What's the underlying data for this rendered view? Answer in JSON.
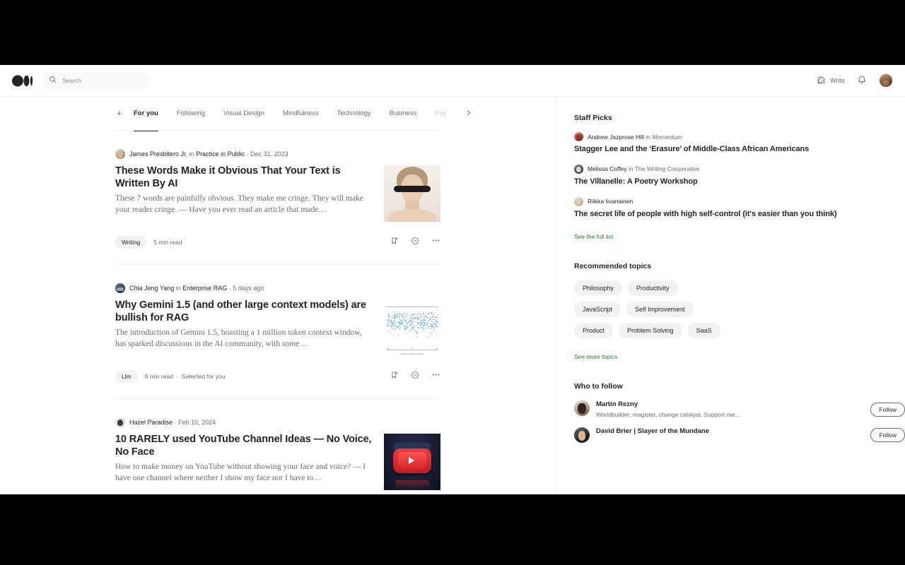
{
  "header": {
    "logo": "medium-logo",
    "search": {
      "placeholder": "Search",
      "value": ""
    },
    "write_label": "Write",
    "notifications_icon": "bell-icon",
    "avatar": "user-avatar"
  },
  "tabs": {
    "add_label": "+",
    "items": [
      {
        "label": "For you",
        "active": true
      },
      {
        "label": "Following",
        "active": false
      },
      {
        "label": "Visual Design",
        "active": false
      },
      {
        "label": "Mindfulness",
        "active": false
      },
      {
        "label": "Technology",
        "active": false
      },
      {
        "label": "Business",
        "active": false
      },
      {
        "label": "Psy",
        "active": false
      }
    ],
    "next_icon": "chevron-right-icon"
  },
  "articles": [
    {
      "author": "James Presbitero Jr.",
      "in_word": "in",
      "publication": "Practice in Public",
      "separator": "·",
      "date": "Dec 31, 2023",
      "title": "These Words Make it Obvious That Your Text is Written By AI",
      "excerpt": "These 7 words are painfully obvious. They make me cringe. They will make your reader cringe. — Have you ever read an article that made…",
      "tag": "Writing",
      "read_time": "5 min read",
      "extra": "",
      "thumb": "portrait-blindfold-thumbnail"
    },
    {
      "author": "Chia Jeng Yang",
      "in_word": "in",
      "publication": "Enterprise RAG",
      "separator": "·",
      "date": "5 days ago",
      "title": "Why Gemini 1.5 (and other large context models) are bullish for RAG",
      "excerpt": "The introduction of Gemini 1.5, boasting a 1 million token context window, has sparked discussions in the AI community, with some…",
      "tag": "Llm",
      "read_time": "6 min read",
      "extra": "Selected for you",
      "thumb": "scatter-chart-thumbnail"
    },
    {
      "author": "Hazel Paradise",
      "in_word": "",
      "publication": "",
      "separator": "·",
      "date": "Feb 10, 2024",
      "title": "10 RARELY used YouTube Channel Ideas — No Voice, No Face",
      "excerpt": "How to make money on YouTube without showing your face and voice? — I have one channel where neither I show my face nor I have to…",
      "tag": "",
      "read_time": "",
      "extra": "",
      "thumb": "youtube-icon-thumbnail"
    }
  ],
  "sidebar": {
    "staff_picks": {
      "title": "Staff Picks",
      "picks": [
        {
          "author": "Andrew Jazprose Hill",
          "in_word": "in",
          "publication": "Momentum",
          "title": "Stagger Lee and the ‘Erasure’ of Middle-Class African Americans"
        },
        {
          "author": "Melissa Coffey",
          "in_word": "in",
          "publication": "The Writing Cooperative",
          "title": "The Villanelle: A Poetry Workshop"
        },
        {
          "author": "Riikka Iivanainen",
          "in_word": "",
          "publication": "",
          "title": "The secret life of people with high self-control (it's easier than you think)"
        }
      ],
      "see_all": "See the full list"
    },
    "recommended_topics": {
      "title": "Recommended topics",
      "topics": [
        "Philosophy",
        "Productivity",
        "JavaScript",
        "Self Improvement",
        "Product",
        "Problem Solving",
        "SaaS"
      ],
      "see_more": "See more topics"
    },
    "who_to_follow": {
      "title": "Who to follow",
      "people": [
        {
          "name": "Martin Rezny",
          "bio": "Worldbuilder, magister, change catalyst. Support me…",
          "button": "Follow"
        },
        {
          "name": "David Brier | Slayer of the Mundane",
          "bio": "",
          "button": "Follow"
        }
      ]
    }
  },
  "colors": {
    "accent_green": "#1a8917",
    "text_primary": "#242424",
    "text_secondary": "#6b6b6b",
    "chip_bg": "#f2f2f2"
  }
}
